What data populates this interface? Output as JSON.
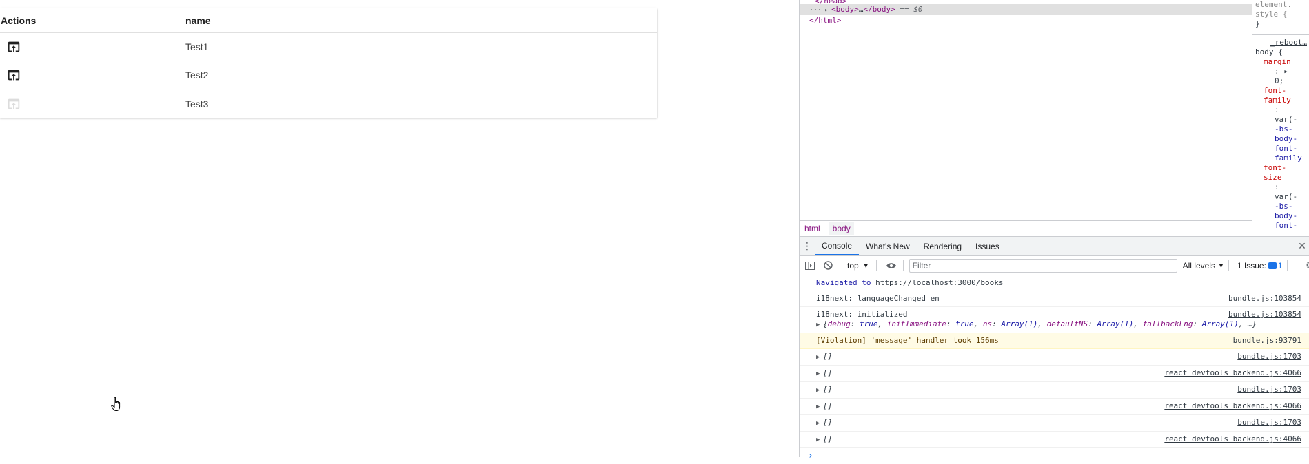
{
  "table": {
    "columns": [
      "Actions",
      "name"
    ],
    "rows": [
      {
        "name": "Test1",
        "action_enabled": true
      },
      {
        "name": "Test2",
        "action_enabled": true
      },
      {
        "name": "Test3",
        "action_enabled": false
      }
    ]
  },
  "devtools": {
    "dom": {
      "body_open": "<body>",
      "body_ellipsis": "…",
      "body_close": "</body>",
      "selected_marker": "== $0",
      "html_close": "</html>"
    },
    "breadcrumbs": [
      "html",
      "body"
    ],
    "styles": {
      "element_style": [
        "element.",
        "style {",
        "}"
      ],
      "source": "_reboot…",
      "rule_selector": "body {",
      "lines": [
        {
          "text": "margin",
          "kind": "prop"
        },
        {
          "text": ": ▸",
          "kind": "plain"
        },
        {
          "text": "0;",
          "kind": "plain"
        },
        {
          "text": "font-",
          "kind": "prop"
        },
        {
          "text": "family",
          "kind": "prop"
        },
        {
          "text": ":",
          "kind": "plain"
        },
        {
          "text": "var(-",
          "kind": "plain"
        },
        {
          "text": "-bs-",
          "kind": "blue"
        },
        {
          "text": "body-",
          "kind": "blue"
        },
        {
          "text": "font-",
          "kind": "blue"
        },
        {
          "text": "family",
          "kind": "blue"
        },
        {
          "text": "font-",
          "kind": "prop"
        },
        {
          "text": "size",
          "kind": "prop"
        },
        {
          "text": ":",
          "kind": "plain"
        },
        {
          "text": "var(-",
          "kind": "plain"
        },
        {
          "text": "-bs-",
          "kind": "blue"
        },
        {
          "text": "body-",
          "kind": "blue"
        },
        {
          "text": "font-",
          "kind": "blue"
        }
      ]
    },
    "drawer_tabs": [
      "Console",
      "What's New",
      "Rendering",
      "Issues"
    ],
    "toolbar": {
      "context": "top",
      "filter_placeholder": "Filter",
      "levels": "All levels",
      "issues_label": "1 Issue:",
      "issues_count": "1"
    },
    "console": {
      "navigated_prefix": "Navigated to ",
      "navigated_url": "https://localhost:3000/books",
      "messages": [
        {
          "text": "i18next: languageChanged en",
          "source": "bundle.js:103854"
        },
        {
          "text": "i18next: initialized",
          "source": "bundle.js:103854"
        }
      ],
      "init_object": {
        "open": "{",
        "pairs": [
          [
            "debug",
            "true"
          ],
          [
            "initImmediate",
            "true"
          ],
          [
            "ns",
            "Array(1)"
          ],
          [
            "defaultNS",
            "Array(1)"
          ],
          [
            "fallbackLng",
            "Array(1)"
          ]
        ],
        "close": "…}"
      },
      "violation": {
        "text": "[Violation] 'message' handler took 156ms",
        "source": "bundle.js:93791"
      },
      "arrays": [
        {
          "text": "[]",
          "source": "bundle.js:1703"
        },
        {
          "text": "[]",
          "source": "react_devtools_backend.js:4066"
        },
        {
          "text": "[]",
          "source": "bundle.js:1703"
        },
        {
          "text": "[]",
          "source": "react_devtools_backend.js:4066"
        },
        {
          "text": "[]",
          "source": "bundle.js:1703"
        },
        {
          "text": "[]",
          "source": "react_devtools_backend.js:4066"
        }
      ],
      "prompt": "›"
    }
  },
  "colors": {
    "devtools_tag": "#881280",
    "warning_bg": "#fffbe5",
    "active_tab": "#1a73e8"
  },
  "icons": [
    "open-in-browser-icon",
    "hand-cursor-icon",
    "kebab-menu-icon",
    "close-icon",
    "sidebar-toggle-icon",
    "clear-console-icon",
    "eye-icon",
    "gear-icon",
    "chat-badge-icon"
  ]
}
